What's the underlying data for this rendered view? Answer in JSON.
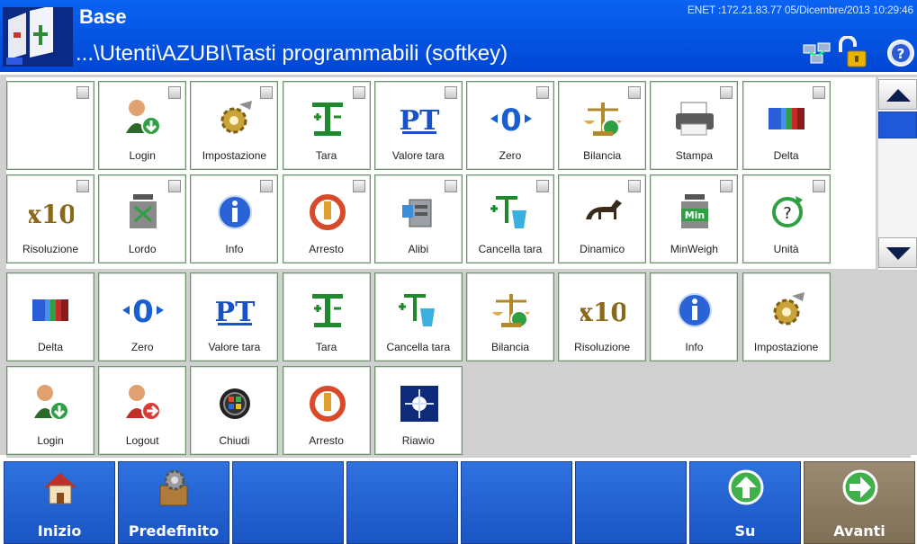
{
  "header": {
    "title": "Base",
    "path": "...\\Utenti\\AZUBI\\Tasti programmabili (softkey)",
    "status": "ENET :172.21.83.77  05/Dicembre/2013 10:29:46"
  },
  "top_tiles": [
    {
      "label": "",
      "icon": "blank"
    },
    {
      "label": "Login",
      "icon": "login-icon"
    },
    {
      "label": "Impostazione",
      "icon": "settings-gear-icon"
    },
    {
      "label": "Tara",
      "icon": "tare-icon"
    },
    {
      "label": "Valore tara",
      "icon": "preset-tare-icon"
    },
    {
      "label": "Zero",
      "icon": "zero-icon"
    },
    {
      "label": "Bilancia",
      "icon": "balance-icon"
    },
    {
      "label": "Stampa",
      "icon": "printer-icon"
    },
    {
      "label": "Delta",
      "icon": "delta-icon"
    },
    {
      "label": "Risoluzione",
      "icon": "x10-icon"
    },
    {
      "label": "Lordo",
      "icon": "gross-weight-icon"
    },
    {
      "label": "Info",
      "icon": "info-icon"
    },
    {
      "label": "Arresto",
      "icon": "stop-icon"
    },
    {
      "label": "Alibi",
      "icon": "alibi-icon"
    },
    {
      "label": "Cancella tara",
      "icon": "clear-tare-icon"
    },
    {
      "label": "Dinamico",
      "icon": "horse-icon"
    },
    {
      "label": "MinWeigh",
      "icon": "minweigh-icon"
    },
    {
      "label": "Unità",
      "icon": "units-icon"
    }
  ],
  "bottom_tiles": [
    {
      "label": "Delta",
      "icon": "delta-icon"
    },
    {
      "label": "Zero",
      "icon": "zero-icon"
    },
    {
      "label": "Valore tara",
      "icon": "preset-tare-icon"
    },
    {
      "label": "Tara",
      "icon": "tare-icon"
    },
    {
      "label": "Cancella tara",
      "icon": "clear-tare-icon"
    },
    {
      "label": "Bilancia",
      "icon": "balance-icon"
    },
    {
      "label": "Risoluzione",
      "icon": "x10-icon"
    },
    {
      "label": "Info",
      "icon": "info-icon"
    },
    {
      "label": "Impostazione",
      "icon": "settings-gear-icon"
    },
    {
      "label": "Login",
      "icon": "login-icon"
    },
    {
      "label": "Logout",
      "icon": "logout-icon"
    },
    {
      "label": "Chiudi",
      "icon": "close-app-icon"
    },
    {
      "label": "Arresto",
      "icon": "stop-icon"
    },
    {
      "label": "Riawio",
      "icon": "restart-icon"
    }
  ],
  "softkeys": [
    {
      "label": "Inizio",
      "icon": "home-icon"
    },
    {
      "label": "Predefinito",
      "icon": "default-gear-box-icon"
    },
    {
      "label": "",
      "icon": ""
    },
    {
      "label": "",
      "icon": ""
    },
    {
      "label": "",
      "icon": ""
    },
    {
      "label": "",
      "icon": ""
    },
    {
      "label": "Su",
      "icon": "arrow-up-icon"
    },
    {
      "label": "Avanti",
      "icon": "arrow-right-icon"
    }
  ]
}
